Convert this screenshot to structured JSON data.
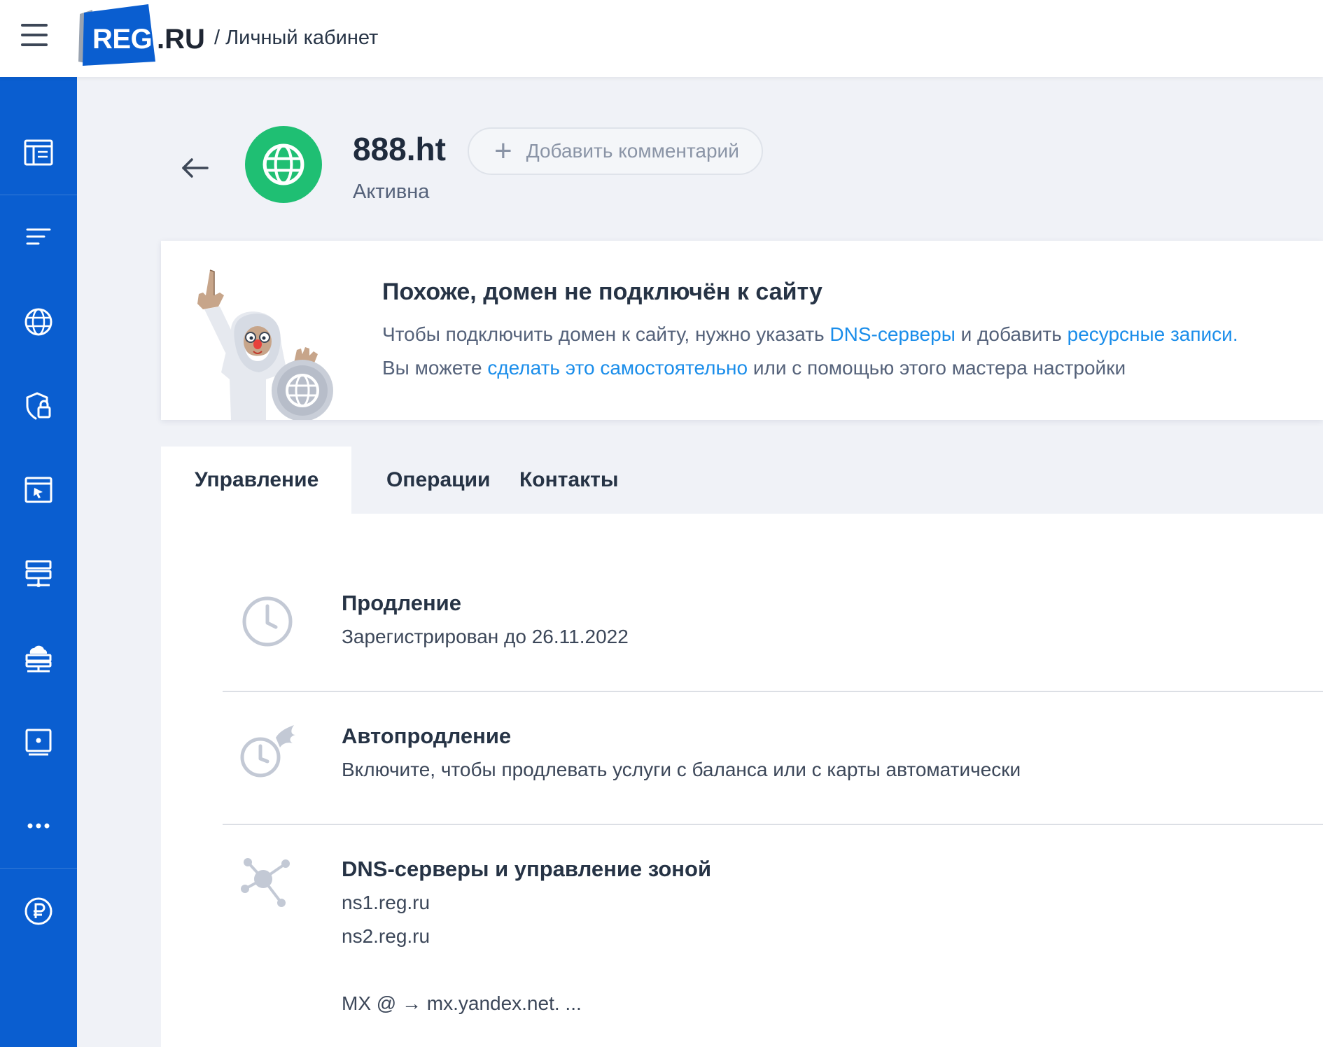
{
  "app": {
    "logo_main": "REG",
    "logo_ru": ".RU",
    "breadcrumb": "/ Личный кабинет",
    "brand_color": "#0a5ed0"
  },
  "sidebar": {
    "items": [
      {
        "icon": "dashboard-icon"
      },
      {
        "icon": "list-icon"
      },
      {
        "icon": "globe-icon"
      },
      {
        "icon": "shield-lock-icon"
      },
      {
        "icon": "website-cursor-icon"
      },
      {
        "icon": "server-icon"
      },
      {
        "icon": "cloud-server-icon"
      },
      {
        "icon": "vps-icon"
      },
      {
        "icon": "more-icon"
      },
      {
        "icon": "ruble-icon"
      }
    ]
  },
  "header": {
    "domain": "888.ht",
    "status": "Активна",
    "status_color": "#1fbf73",
    "comment_button": "Добавить комментарий"
  },
  "notice": {
    "title": "Похоже, домен не подключён к сайту",
    "line1_a": "Чтобы подключить домен к сайту, нужно указать ",
    "line1_link1": "DNS-серверы",
    "line1_b": " и добавить ",
    "line1_link2": "ресурсные записи",
    "line1_c": ".",
    "line2_a": "Вы можете ",
    "line2_link": "сделать это самостоятельно",
    "line2_b": " или с помощью этого мастера настройки",
    "link_color": "#1a8dea"
  },
  "tabs": [
    {
      "label": "Управление",
      "active": true
    },
    {
      "label": "Операции",
      "active": false
    },
    {
      "label": "Контакты",
      "active": false
    }
  ],
  "sections": {
    "renewal": {
      "title": "Продление",
      "text": "Зарегистрирован до 26.11.2022"
    },
    "autorenew": {
      "title": "Автопродление",
      "text": "Включите, чтобы продлевать услуги с баланса или с карты автоматически"
    },
    "dns": {
      "title": "DNS-серверы и управление зоной",
      "ns1": "ns1.reg.ru",
      "ns2": "ns2.reg.ru",
      "mx": "MX @ → mx.yandex.net. ..."
    }
  }
}
